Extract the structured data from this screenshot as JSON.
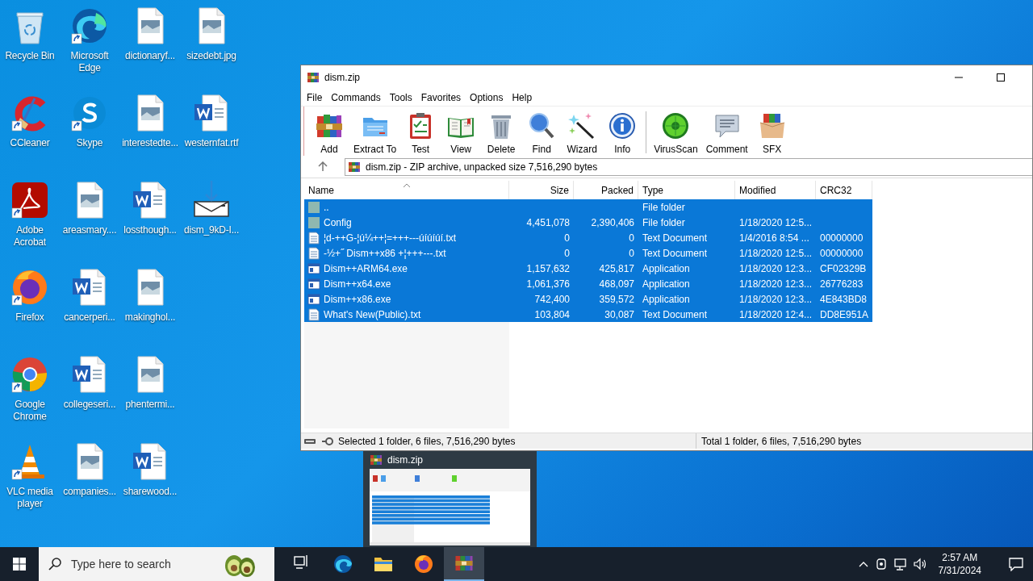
{
  "desktop": {
    "icons": [
      {
        "label": "Recycle Bin",
        "kind": "recycle",
        "shortcut": false
      },
      {
        "label": "CCleaner",
        "kind": "ccleaner",
        "shortcut": true
      },
      {
        "label": "Adobe Acrobat",
        "kind": "acrobat",
        "shortcut": true
      },
      {
        "label": "Firefox",
        "kind": "firefox",
        "shortcut": true
      },
      {
        "label": "Google Chrome",
        "kind": "chrome",
        "shortcut": true
      },
      {
        "label": "VLC media player",
        "kind": "vlc",
        "shortcut": true
      },
      {
        "label": "Microsoft Edge",
        "kind": "edge",
        "shortcut": true
      },
      {
        "label": "Skype",
        "kind": "skype",
        "shortcut": true
      },
      {
        "label": "areasmary....",
        "kind": "image",
        "shortcut": false
      },
      {
        "label": "cancerperi...",
        "kind": "word",
        "shortcut": false
      },
      {
        "label": "collegeseri...",
        "kind": "word",
        "shortcut": false
      },
      {
        "label": "companies...",
        "kind": "image",
        "shortcut": false
      },
      {
        "label": "dictionaryf...",
        "kind": "image",
        "shortcut": false
      },
      {
        "label": "interestedte...",
        "kind": "image",
        "shortcut": false
      },
      {
        "label": "lossthough...",
        "kind": "word",
        "shortcut": false
      },
      {
        "label": "makinghol...",
        "kind": "image",
        "shortcut": false
      },
      {
        "label": "phentermi...",
        "kind": "image",
        "shortcut": false
      },
      {
        "label": "sharewood...",
        "kind": "word",
        "shortcut": false
      },
      {
        "label": "sizedebt.jpg",
        "kind": "image",
        "shortcut": false
      },
      {
        "label": "westernfat.rtf",
        "kind": "word",
        "shortcut": false
      },
      {
        "label": "dism_9kD-I...",
        "kind": "download",
        "shortcut": false
      }
    ]
  },
  "window": {
    "title": "dism.zip",
    "menu": [
      "File",
      "Commands",
      "Tools",
      "Favorites",
      "Options",
      "Help"
    ],
    "toolbar": [
      {
        "label": "Add",
        "kind": "add"
      },
      {
        "label": "Extract To",
        "kind": "extract"
      },
      {
        "label": "Test",
        "kind": "test"
      },
      {
        "label": "View",
        "kind": "view"
      },
      {
        "label": "Delete",
        "kind": "delete"
      },
      {
        "label": "Find",
        "kind": "find"
      },
      {
        "label": "Wizard",
        "kind": "wizard"
      },
      {
        "label": "Info",
        "kind": "info"
      },
      {
        "kind": "separator"
      },
      {
        "label": "VirusScan",
        "kind": "virusscan"
      },
      {
        "label": "Comment",
        "kind": "comment"
      },
      {
        "label": "SFX",
        "kind": "sfx"
      }
    ],
    "address": "dism.zip - ZIP archive, unpacked size 7,516,290 bytes",
    "columns": [
      "Name",
      "Size",
      "Packed",
      "Type",
      "Modified",
      "CRC32"
    ],
    "rows": [
      {
        "kind": "up",
        "name": "..",
        "type": "File folder",
        "selected": true
      },
      {
        "kind": "folder",
        "name": "Config",
        "size": "4,451,078",
        "packed": "2,390,406",
        "type": "File folder",
        "modified": "1/18/2020 12:5...",
        "selected": true
      },
      {
        "kind": "text",
        "name": "¦d-++G-¦ú¼++¦=+++---úíúíúí.txt",
        "size": "0",
        "packed": "0",
        "type": "Text Document",
        "modified": "1/4/2016 8:54 ...",
        "crc": "00000000",
        "selected": true
      },
      {
        "kind": "text",
        "name": "-½+˝ Dism++x86 +¦+++---.txt",
        "size": "0",
        "packed": "0",
        "type": "Text Document",
        "modified": "1/18/2020 12:5...",
        "crc": "00000000",
        "selected": true
      },
      {
        "kind": "app",
        "name": "Dism++ARM64.exe",
        "size": "1,157,632",
        "packed": "425,817",
        "type": "Application",
        "modified": "1/18/2020 12:3...",
        "crc": "CF02329B",
        "selected": true
      },
      {
        "kind": "app",
        "name": "Dism++x64.exe",
        "size": "1,061,376",
        "packed": "468,097",
        "type": "Application",
        "modified": "1/18/2020 12:3...",
        "crc": "26776283",
        "selected": true
      },
      {
        "kind": "app",
        "name": "Dism++x86.exe",
        "size": "742,400",
        "packed": "359,572",
        "type": "Application",
        "modified": "1/18/2020 12:3...",
        "crc": "4E843BD8",
        "selected": true
      },
      {
        "kind": "text",
        "name": "What's New(Public).txt",
        "size": "103,804",
        "packed": "30,087",
        "type": "Text Document",
        "modified": "1/18/2020 12:4...",
        "crc": "DD8E951A",
        "selected": true
      }
    ],
    "status": {
      "selection": "Selected 1 folder, 6 files, 7,516,290 bytes",
      "total": "Total 1 folder, 6 files, 7,516,290 bytes"
    }
  },
  "thumbnail_popup": {
    "title": "dism.zip"
  },
  "taskbar": {
    "search": {
      "placeholder": "Type here to search"
    },
    "apps": [
      {
        "kind": "taskview",
        "active": false
      },
      {
        "kind": "edge",
        "active": false
      },
      {
        "kind": "explorer",
        "active": false
      },
      {
        "kind": "firefox",
        "active": false
      },
      {
        "kind": "winrar",
        "active": true
      }
    ],
    "clock": {
      "time": "2:57 AM",
      "date": "7/31/2024"
    }
  }
}
